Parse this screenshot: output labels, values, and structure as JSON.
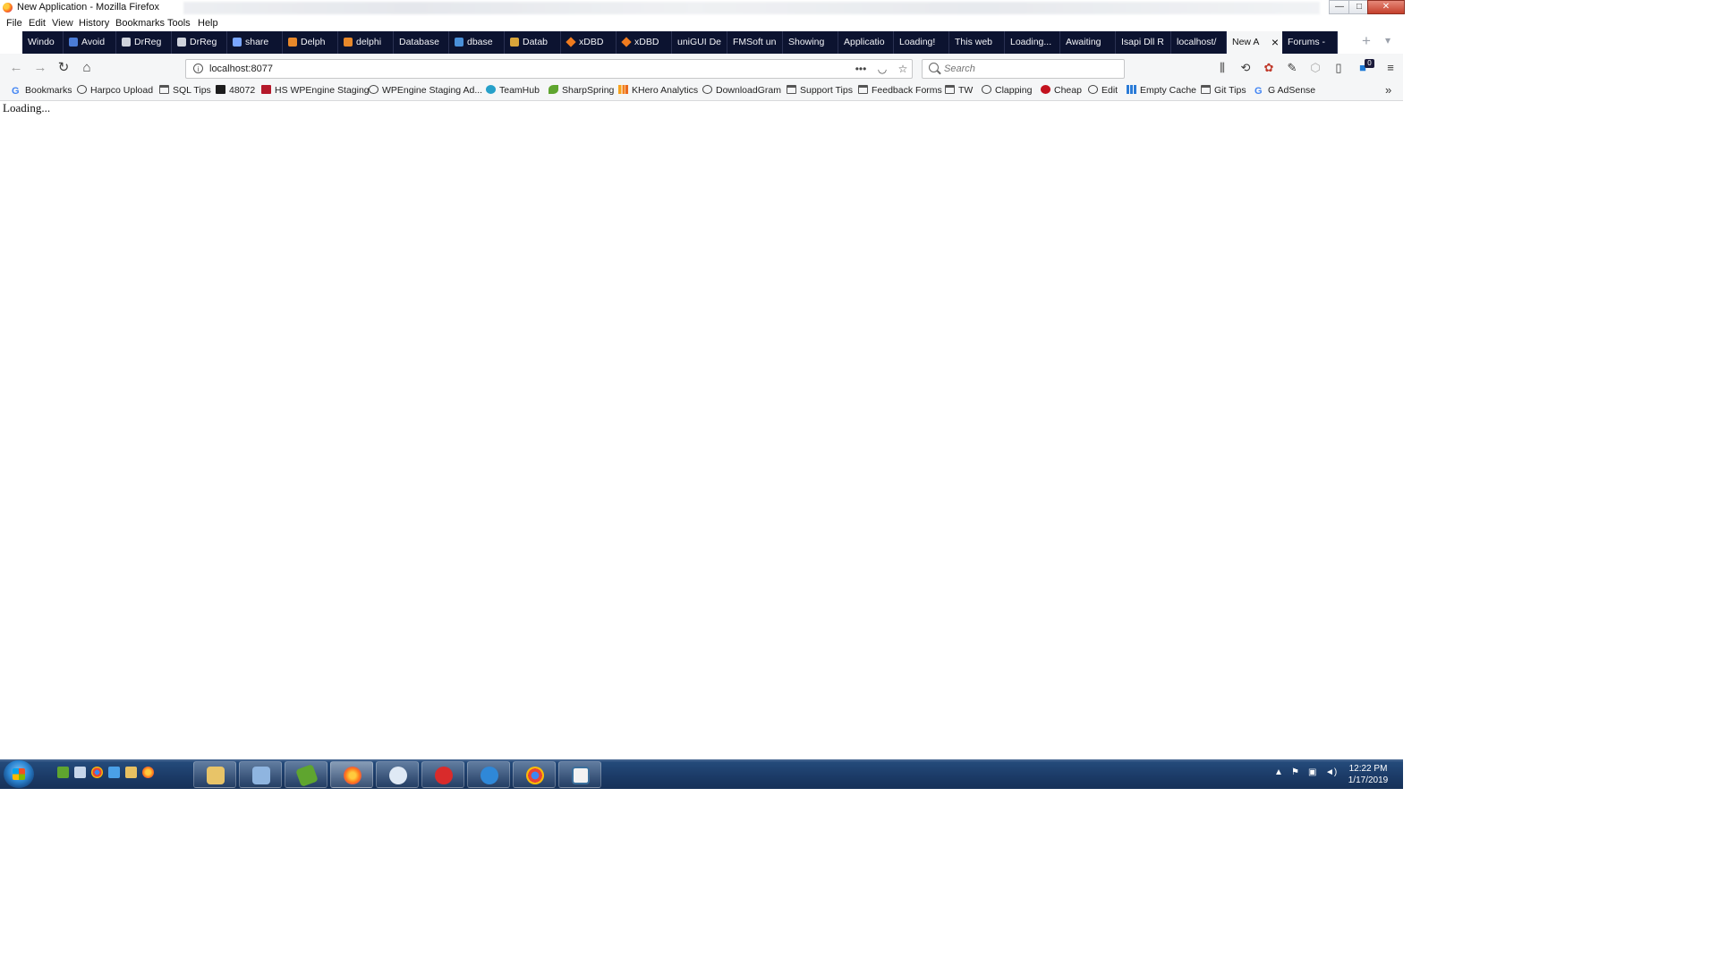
{
  "window": {
    "title": "New Application - Mozilla Firefox",
    "controls": {
      "minimize": "—",
      "maximize": "□",
      "close": "✕"
    }
  },
  "menubar": [
    "File",
    "Edit",
    "View",
    "History",
    "Bookmarks",
    "Tools",
    "Help"
  ],
  "tabs": [
    {
      "label": "Windo",
      "icon": "none"
    },
    {
      "label": "Avoid",
      "icon": "bracket-icon"
    },
    {
      "label": "DrReg",
      "icon": "drreg-icon"
    },
    {
      "label": "DrReg",
      "icon": "drreg-icon"
    },
    {
      "label": "share",
      "icon": "medium-icon"
    },
    {
      "label": "Delph",
      "icon": "delphi-icon"
    },
    {
      "label": "delphi",
      "icon": "delphi-icon"
    },
    {
      "label": "Database",
      "icon": "none"
    },
    {
      "label": "dbase",
      "icon": "dbase-icon"
    },
    {
      "label": "Datab",
      "icon": "stack-icon"
    },
    {
      "label": "xDBD",
      "icon": "diamond-icon"
    },
    {
      "label": "xDBD",
      "icon": "diamond-icon"
    },
    {
      "label": "uniGUI De",
      "icon": "none"
    },
    {
      "label": "FMSoft un",
      "icon": "none"
    },
    {
      "label": "Showing",
      "icon": "none"
    },
    {
      "label": "Applicatio",
      "icon": "none"
    },
    {
      "label": "Loading!",
      "icon": "none"
    },
    {
      "label": "This web",
      "icon": "none"
    },
    {
      "label": "Loading...",
      "icon": "none"
    },
    {
      "label": "Awaiting",
      "icon": "none"
    },
    {
      "label": "Isapi Dll R",
      "icon": "none"
    },
    {
      "label": "localhost/",
      "icon": "none"
    },
    {
      "label": "New A",
      "icon": "none",
      "active": true
    },
    {
      "label": "Forums -",
      "icon": "none"
    }
  ],
  "navbar": {
    "url": "localhost:8077",
    "search_placeholder": "Search",
    "addon_badge": "0"
  },
  "bookmarks": [
    {
      "label": "Bookmarks",
      "icon": "g"
    },
    {
      "label": "Harpco Upload",
      "icon": "globe"
    },
    {
      "label": "SQL Tips",
      "icon": "folder"
    },
    {
      "label": "48072",
      "icon": "dark"
    },
    {
      "label": "HS WPEngine Staging",
      "icon": "red"
    },
    {
      "label": "WPEngine Staging Ad...",
      "icon": "globe"
    },
    {
      "label": "TeamHub",
      "icon": "teal"
    },
    {
      "label": "SharpSpring",
      "icon": "green"
    },
    {
      "label": "KHero Analytics",
      "icon": "orange"
    },
    {
      "label": "DownloadGram",
      "icon": "globe"
    },
    {
      "label": "Support Tips",
      "icon": "folder"
    },
    {
      "label": "Feedback Forms",
      "icon": "folder"
    },
    {
      "label": "TW",
      "icon": "folder"
    },
    {
      "label": "Clapping",
      "icon": "globe"
    },
    {
      "label": "Cheap",
      "icon": "redc"
    },
    {
      "label": "Edit",
      "icon": "globe"
    },
    {
      "label": "Empty Cache",
      "icon": "grid"
    },
    {
      "label": "Git Tips",
      "icon": "folder"
    },
    {
      "label": "G AdSense",
      "icon": "g"
    }
  ],
  "page": {
    "text": "Loading..."
  },
  "taskbar": {
    "time": "12:22 PM",
    "date": "1/17/2019"
  },
  "colors": {
    "tabstrip": "#0c1330",
    "taskbar": "#1b3a66",
    "toolbar": "#f5f6f7"
  }
}
